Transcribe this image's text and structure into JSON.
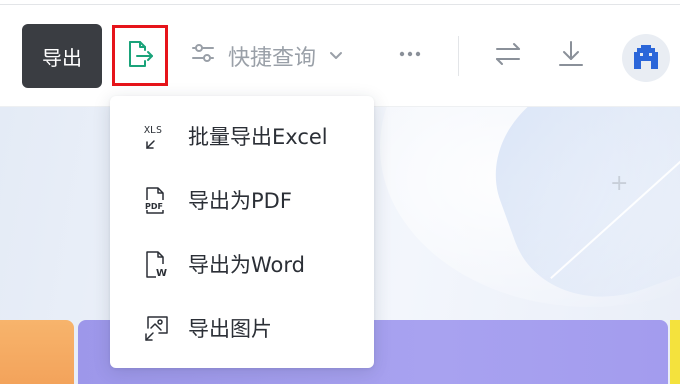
{
  "toolbar": {
    "tooltip_text": "导出",
    "export_icon": "export-file-icon",
    "quick_query_label": "快捷查询",
    "quick_query_icon": "sliders-icon",
    "more_icon": "more-horizontal-icon",
    "swap_icon": "swap-arrows-icon",
    "download_icon": "download-icon",
    "avatar_icon": "avatar-icon",
    "highlight_color": "#e6141a",
    "accent_color": "#1aa37a"
  },
  "export_menu": {
    "items": [
      {
        "label": "批量导出Excel",
        "icon": "xls-file-icon"
      },
      {
        "label": "导出为PDF",
        "icon": "pdf-file-icon"
      },
      {
        "label": "导出为Word",
        "icon": "word-file-icon"
      },
      {
        "label": "导出图片",
        "icon": "image-file-icon"
      }
    ]
  },
  "colors": {
    "tooltip_bg": "#3a3d42",
    "banner_bg": "#e9eef8",
    "card_orange": "#f3a35b",
    "card_purple": "#a39cee",
    "card_yellow": "#f4e23d"
  }
}
